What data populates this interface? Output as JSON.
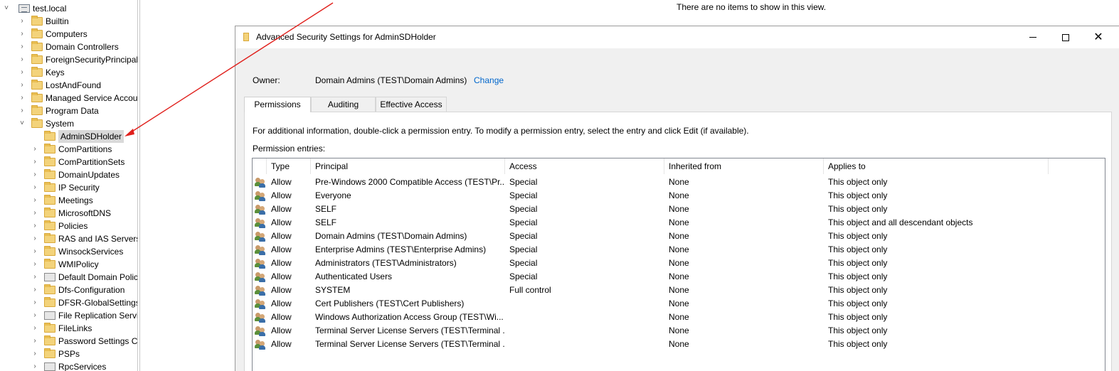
{
  "tree": {
    "root": "test.local",
    "children": [
      "Builtin",
      "Computers",
      "Domain Controllers",
      "ForeignSecurityPrincipals",
      "Keys",
      "LostAndFound",
      "Managed Service Accounts",
      "Program Data",
      "System"
    ],
    "system_children": [
      "AdminSDHolder",
      "ComPartitions",
      "ComPartitionSets",
      "DomainUpdates",
      "IP Security",
      "Meetings",
      "MicrosoftDNS",
      "Policies",
      "RAS and IAS Servers Access Check",
      "WinsockServices",
      "WMIPolicy",
      "Default Domain Policy",
      "Dfs-Configuration",
      "DFSR-GlobalSettings",
      "File Replication Service",
      "FileLinks",
      "Password Settings Container",
      "PSPs",
      "RpcServices"
    ]
  },
  "empty_message": "There are no items to show in this view.",
  "dialog": {
    "title": "Advanced Security Settings for AdminSDHolder",
    "owner_label": "Owner:",
    "owner_value": "Domain Admins (TEST\\Domain Admins)",
    "owner_change": "Change",
    "tabs": [
      "Permissions",
      "Auditing",
      "Effective Access"
    ],
    "info_text": "For additional information, double-click a permission entry. To modify a permission entry, select the entry and click Edit (if available).",
    "entries_label": "Permission entries:",
    "columns": [
      "Type",
      "Principal",
      "Access",
      "Inherited from",
      "Applies to"
    ],
    "rows": [
      [
        "Allow",
        "Pre-Windows 2000 Compatible Access (TEST\\Pr...",
        "Special",
        "None",
        "This object only"
      ],
      [
        "Allow",
        "Everyone",
        "Special",
        "None",
        "This object only"
      ],
      [
        "Allow",
        "SELF",
        "Special",
        "None",
        "This object only"
      ],
      [
        "Allow",
        "SELF",
        "Special",
        "None",
        "This object and all descendant objects"
      ],
      [
        "Allow",
        "Domain Admins (TEST\\Domain Admins)",
        "Special",
        "None",
        "This object only"
      ],
      [
        "Allow",
        "Enterprise Admins (TEST\\Enterprise Admins)",
        "Special",
        "None",
        "This object only"
      ],
      [
        "Allow",
        "Administrators (TEST\\Administrators)",
        "Special",
        "None",
        "This object only"
      ],
      [
        "Allow",
        "Authenticated Users",
        "Special",
        "None",
        "This object only"
      ],
      [
        "Allow",
        "SYSTEM",
        "Full control",
        "None",
        "This object only"
      ],
      [
        "Allow",
        "Cert Publishers (TEST\\Cert Publishers)",
        "",
        "None",
        "This object only"
      ],
      [
        "Allow",
        "Windows Authorization Access Group (TEST\\Wi...",
        "",
        "None",
        "This object only"
      ],
      [
        "Allow",
        "Terminal Server License Servers (TEST\\Terminal ...",
        "",
        "None",
        "This object only"
      ],
      [
        "Allow",
        "Terminal Server License Servers (TEST\\Terminal ...",
        "",
        "None",
        "This object only"
      ]
    ]
  },
  "colors": {
    "link": "#0066cc",
    "arrow": "#e0201c",
    "selected_bg": "#d9d9d9"
  }
}
